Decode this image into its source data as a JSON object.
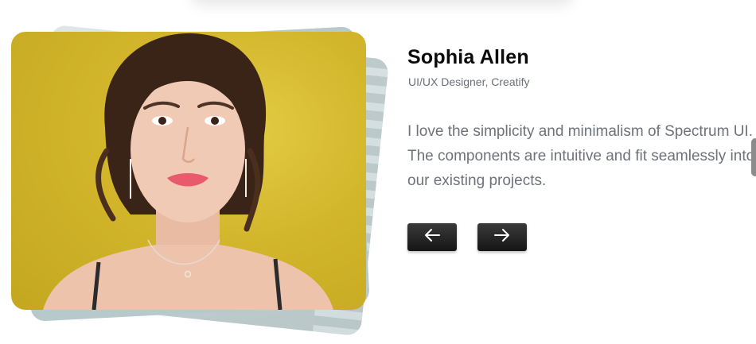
{
  "testimonial": {
    "name": "Sophia Allen",
    "role": "UI/UX Designer, Creatify",
    "quote": "I love the simplicity and minimalism of Spectrum UI. The components are intuitive and fit seamlessly into our existing projects."
  },
  "navigation": {
    "prev_icon": "arrow-left-icon",
    "next_icon": "arrow-right-icon"
  },
  "colors": {
    "photo_background": "#d2b52a",
    "button_background": "#1e1e1e",
    "name_text": "#0b0b0b",
    "body_text": "#6e727b"
  }
}
